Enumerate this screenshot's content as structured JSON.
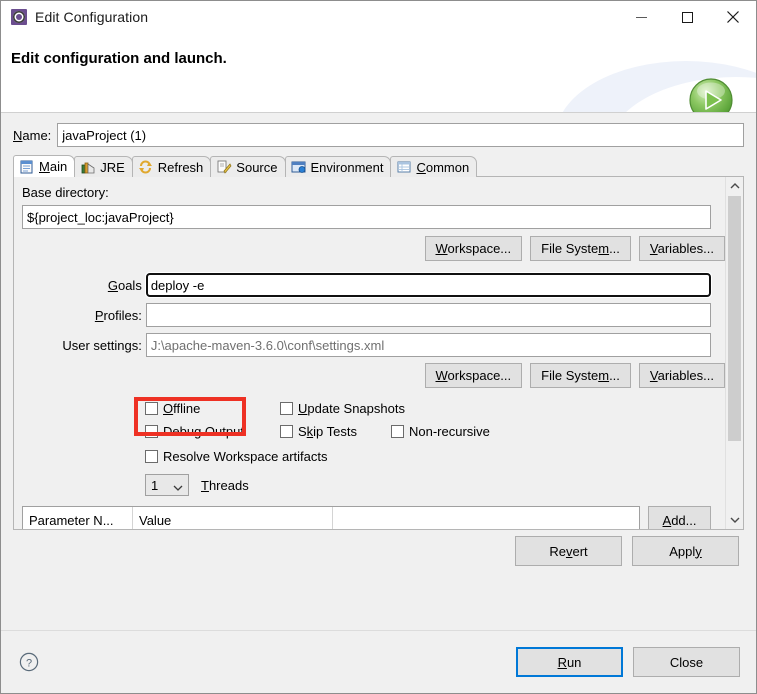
{
  "window": {
    "title": "Edit Configuration",
    "icon": "eclipse-config-icon",
    "minimize_label": "Minimize",
    "maximize_label": "Maximize",
    "close_label": "Close"
  },
  "header": {
    "title": "Edit configuration and launch.",
    "run_icon": "green-run-play-icon"
  },
  "name_field": {
    "label": "Name:",
    "label_mnemonic": "N",
    "value": "javaProject (1)"
  },
  "tabs": [
    {
      "label": "Main",
      "mnemonic": "M",
      "icon": "main-document-icon",
      "active": true
    },
    {
      "label": "JRE",
      "mnemonic": "",
      "icon": "jre-books-icon",
      "active": false
    },
    {
      "label": "Refresh",
      "mnemonic": "",
      "icon": "refresh-arrows-icon",
      "active": false
    },
    {
      "label": "Source",
      "mnemonic": "",
      "icon": "source-pencil-icon",
      "active": false
    },
    {
      "label": "Environment",
      "mnemonic": "",
      "icon": "environment-window-icon",
      "active": false
    },
    {
      "label": "Common",
      "mnemonic": "C",
      "icon": "common-table-icon",
      "active": false
    }
  ],
  "main_tab": {
    "base_directory": {
      "label": "Base directory:",
      "value": "${project_loc:javaProject}"
    },
    "dir_buttons": [
      {
        "label": "Workspace...",
        "mnemonic": "W"
      },
      {
        "label": "File System...",
        "mnemonic": "m"
      },
      {
        "label": "Variables...",
        "mnemonic": "V"
      }
    ],
    "goals": {
      "label": "Goals",
      "mnemonic": "G",
      "value": "deploy -e",
      "focused": true,
      "highlight_color": "#ee3124"
    },
    "profiles": {
      "label": "Profiles:",
      "mnemonic": "P",
      "value": ""
    },
    "user_settings": {
      "label": "User settings:",
      "value": "J:\\apache-maven-3.6.0\\conf\\settings.xml",
      "value_is_dim": true
    },
    "settings_buttons": [
      {
        "label": "Workspace...",
        "mnemonic": "W"
      },
      {
        "label": "File System...",
        "mnemonic": "m"
      },
      {
        "label": "Variables...",
        "mnemonic": "V"
      }
    ],
    "checkboxes": [
      {
        "label": "Offline",
        "mnemonic": "O",
        "checked": false
      },
      {
        "label": "Update Snapshots",
        "mnemonic": "U",
        "checked": false
      },
      {
        "label": "Debug Output",
        "mnemonic": "g",
        "checked": false
      },
      {
        "label": "Skip Tests",
        "mnemonic": "k",
        "checked": false
      },
      {
        "label": "Non-recursive",
        "mnemonic": "",
        "checked": false
      },
      {
        "label": "Resolve Workspace artifacts",
        "mnemonic": "",
        "checked": false
      }
    ],
    "threads": {
      "value": "1",
      "label": "Threads",
      "mnemonic": "T"
    },
    "parameters_table": {
      "columns": [
        "Parameter N...",
        "Value"
      ],
      "rows": []
    },
    "add_button": {
      "label": "Add...",
      "mnemonic": "A"
    }
  },
  "action_buttons": [
    {
      "label": "Revert",
      "mnemonic": "v"
    },
    {
      "label": "Apply",
      "mnemonic": "y"
    }
  ],
  "bottom_bar": {
    "help_icon": "help-question-icon",
    "buttons": [
      {
        "label": "Run",
        "mnemonic": "R",
        "default": true
      },
      {
        "label": "Close",
        "mnemonic": "",
        "default": false
      }
    ]
  }
}
